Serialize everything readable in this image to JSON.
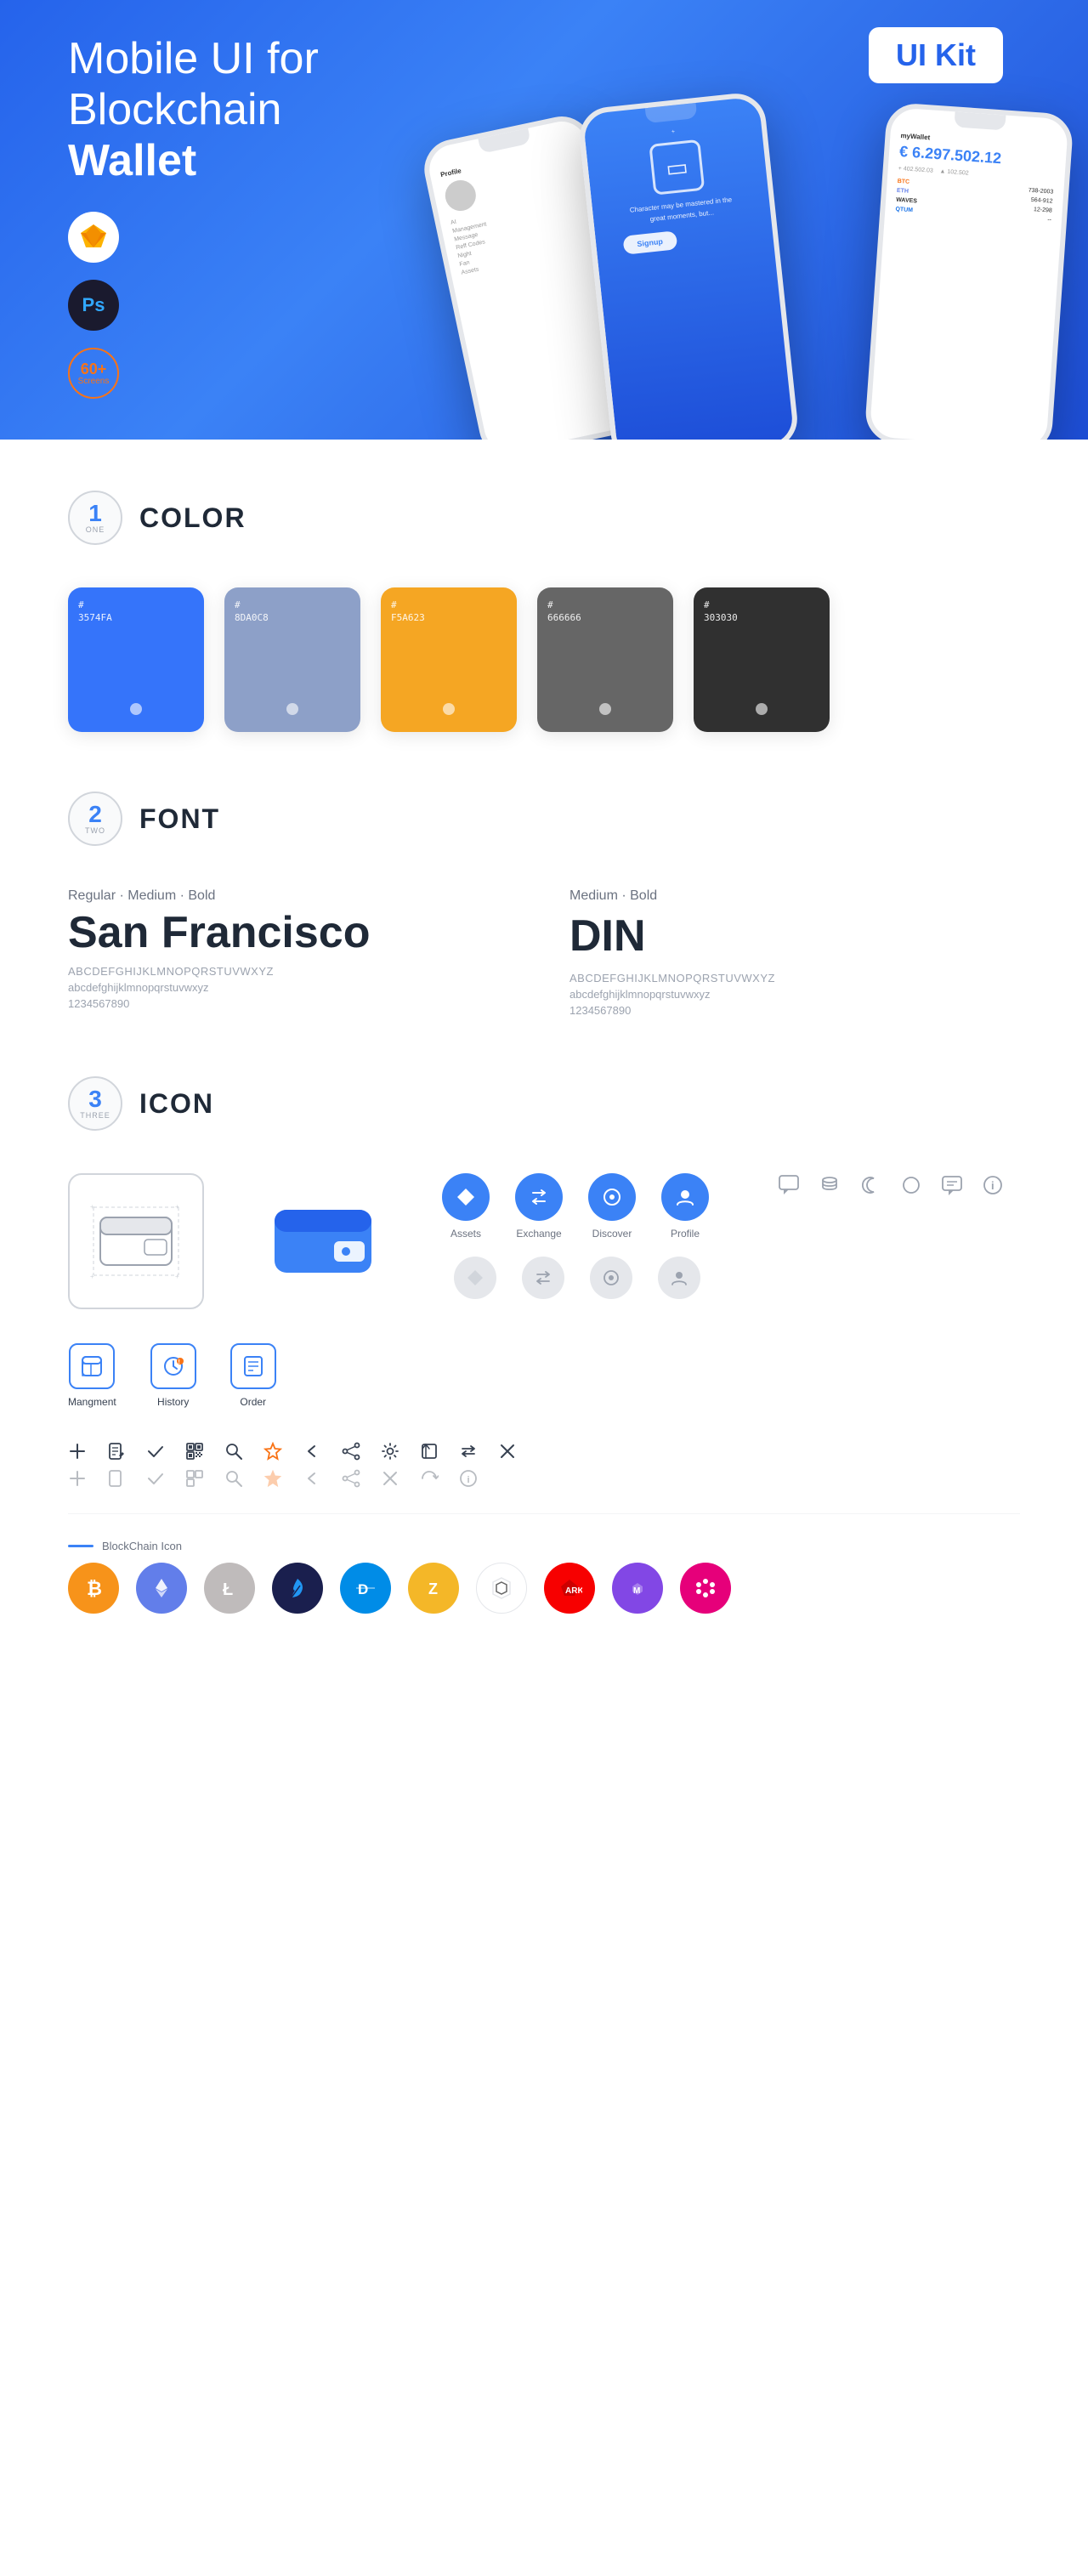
{
  "hero": {
    "title_normal": "Mobile UI for Blockchain",
    "title_bold": "Wallet",
    "ui_kit_badge": "UI Kit",
    "badge_sketch": "Sketch",
    "badge_ps": "Ps",
    "badge_screens_number": "60+",
    "badge_screens_label": "Screens"
  },
  "sections": {
    "color": {
      "number": "1",
      "word": "ONE",
      "title": "COLOR",
      "swatches": [
        {
          "hex": "#3574FA",
          "hex_display": "#\n3574FA",
          "bg": "#3574FA"
        },
        {
          "hex": "#8DA0C8",
          "hex_display": "#\n8DA0C8",
          "bg": "#8DA0C8"
        },
        {
          "hex": "#F5A623",
          "hex_display": "#\nF5A623",
          "bg": "#F5A623"
        },
        {
          "hex": "#666666",
          "hex_display": "#\n666666",
          "bg": "#666666"
        },
        {
          "hex": "#303030",
          "hex_display": "#\n303030",
          "bg": "#303030"
        }
      ]
    },
    "font": {
      "number": "2",
      "word": "TWO",
      "title": "FONT",
      "font1": {
        "styles": "Regular · Medium · Bold",
        "name": "San Francisco",
        "uppercase": "ABCDEFGHIJKLMNOPQRSTUVWXYZ",
        "lowercase": "abcdefghijklmnopqrstuvwxyz",
        "numbers": "1234567890"
      },
      "font2": {
        "styles": "Medium · Bold",
        "name": "DIN",
        "uppercase": "ABCDEFGHIJKLMNOPQRSTUVWXYZ",
        "lowercase": "abcdefghijklmnopqrstuvwxyz",
        "numbers": "1234567890"
      }
    },
    "icon": {
      "number": "3",
      "word": "THREE",
      "title": "ICON",
      "nav_icons": [
        {
          "label": "Assets",
          "icon": "◆"
        },
        {
          "label": "Exchange",
          "icon": "⇄"
        },
        {
          "label": "Discover",
          "icon": "●"
        },
        {
          "label": "Profile",
          "icon": "👤"
        }
      ],
      "mgmt_icons": [
        {
          "label": "Mangment",
          "icon": "▣"
        },
        {
          "label": "History",
          "icon": "⊙"
        },
        {
          "label": "Order",
          "icon": "≡"
        }
      ],
      "blockchain_label": "BlockChain Icon",
      "crypto": [
        {
          "symbol": "₿",
          "label": "Bitcoin",
          "class": "ci-bitcoin"
        },
        {
          "symbol": "⬡",
          "label": "Ethereum",
          "class": "ci-eth"
        },
        {
          "symbol": "Ł",
          "label": "Litecoin",
          "class": "ci-ltc"
        },
        {
          "symbol": "✦",
          "label": "BlackCoin",
          "class": "ci-feather"
        },
        {
          "symbol": "D",
          "label": "Dash",
          "class": "ci-dash"
        },
        {
          "symbol": "Z",
          "label": "Zcash",
          "class": "ci-z"
        },
        {
          "symbol": "✦",
          "label": "IOTA",
          "class": "ci-iota"
        },
        {
          "symbol": "A",
          "label": "ARK",
          "class": "ci-ark"
        },
        {
          "symbol": "⬡",
          "label": "Polygon",
          "class": "ci-matic"
        },
        {
          "symbol": "•",
          "label": "Polkadot",
          "class": "ci-dot"
        }
      ]
    }
  }
}
